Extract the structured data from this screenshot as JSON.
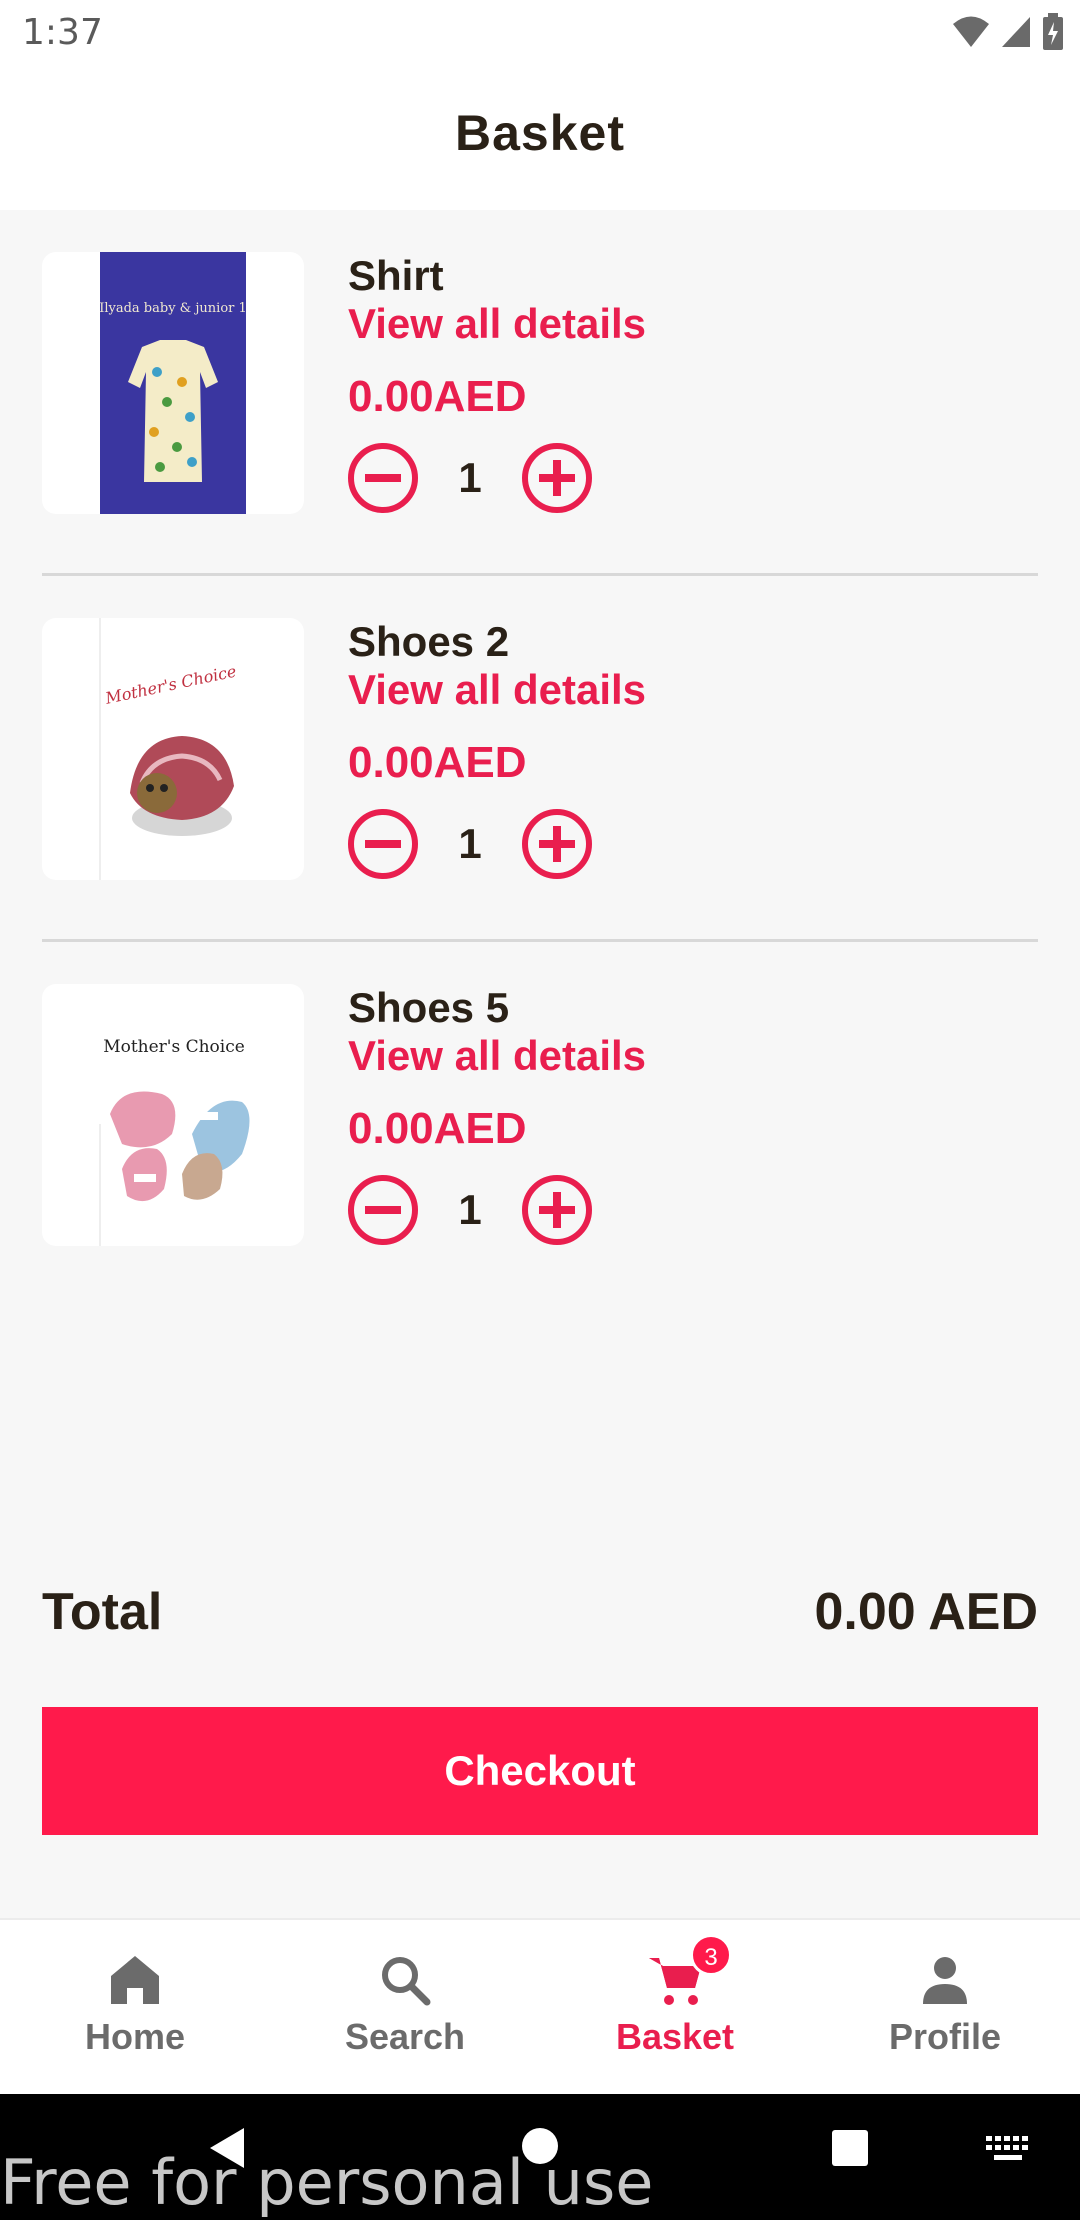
{
  "status_bar": {
    "time": "1:37"
  },
  "header": {
    "title": "Basket"
  },
  "cart": {
    "items": [
      {
        "name": "Shirt",
        "details_link": "View all details",
        "price": "0.00AED",
        "quantity": "1"
      },
      {
        "name": "Shoes 2",
        "details_link": "View all details",
        "price": "0.00AED",
        "quantity": "1"
      },
      {
        "name": "Shoes 5",
        "details_link": "View all details",
        "price": "0.00AED",
        "quantity": "1"
      }
    ]
  },
  "summary": {
    "total_label": "Total",
    "total_value": "0.00 AED"
  },
  "checkout": {
    "label": "Checkout"
  },
  "bottom_nav": {
    "items": [
      {
        "label": "Home",
        "icon": "home-icon",
        "active": false
      },
      {
        "label": "Search",
        "icon": "search-icon",
        "active": false
      },
      {
        "label": "Basket",
        "icon": "cart-icon",
        "active": true,
        "badge": "3"
      },
      {
        "label": "Profile",
        "icon": "person-icon",
        "active": false
      }
    ]
  },
  "product_images": {
    "shirt_brand": "Ilyada baby & junior 1",
    "shoes2_brand": "Mother's Choice",
    "shoes5_brand": "Mother's Choice"
  },
  "watermark": "Free for personal use",
  "colors": {
    "accent": "#e91e4e",
    "button": "#ff1a4b",
    "text": "#2a2117",
    "nav_inactive": "#6b6b6b"
  }
}
